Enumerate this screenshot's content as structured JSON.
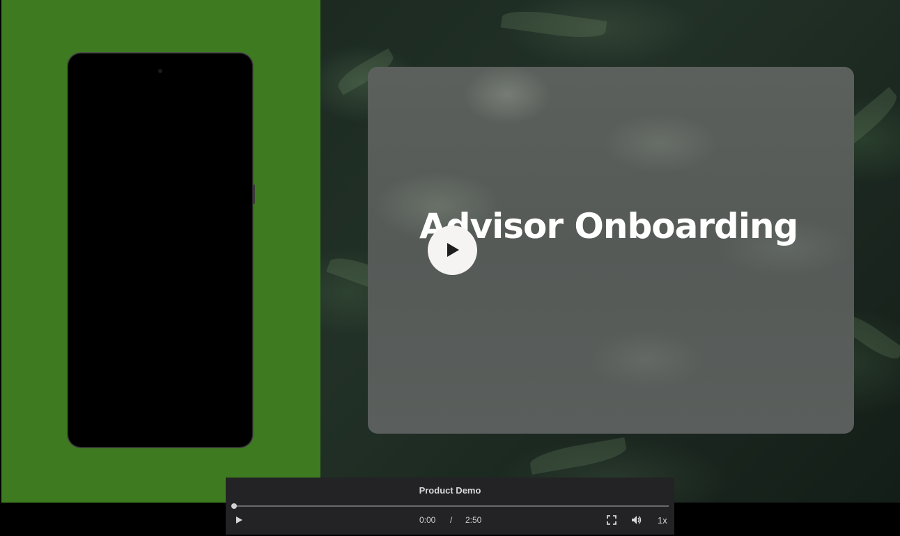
{
  "slide": {
    "title": "Advisor Onboarding"
  },
  "player": {
    "video_title": "Product Demo",
    "current_time": "0:00",
    "separator": "/",
    "duration": "2:50",
    "speed": "1x",
    "progress_fraction": 0.0
  },
  "colors": {
    "green_panel": "#3e7b20",
    "controls_bg": "#232325",
    "play_button_bg": "#f6f4f2"
  },
  "icons": {
    "big_play": "play-icon",
    "play": "play-icon",
    "fullscreen": "fullscreen-icon",
    "volume": "volume-icon"
  }
}
